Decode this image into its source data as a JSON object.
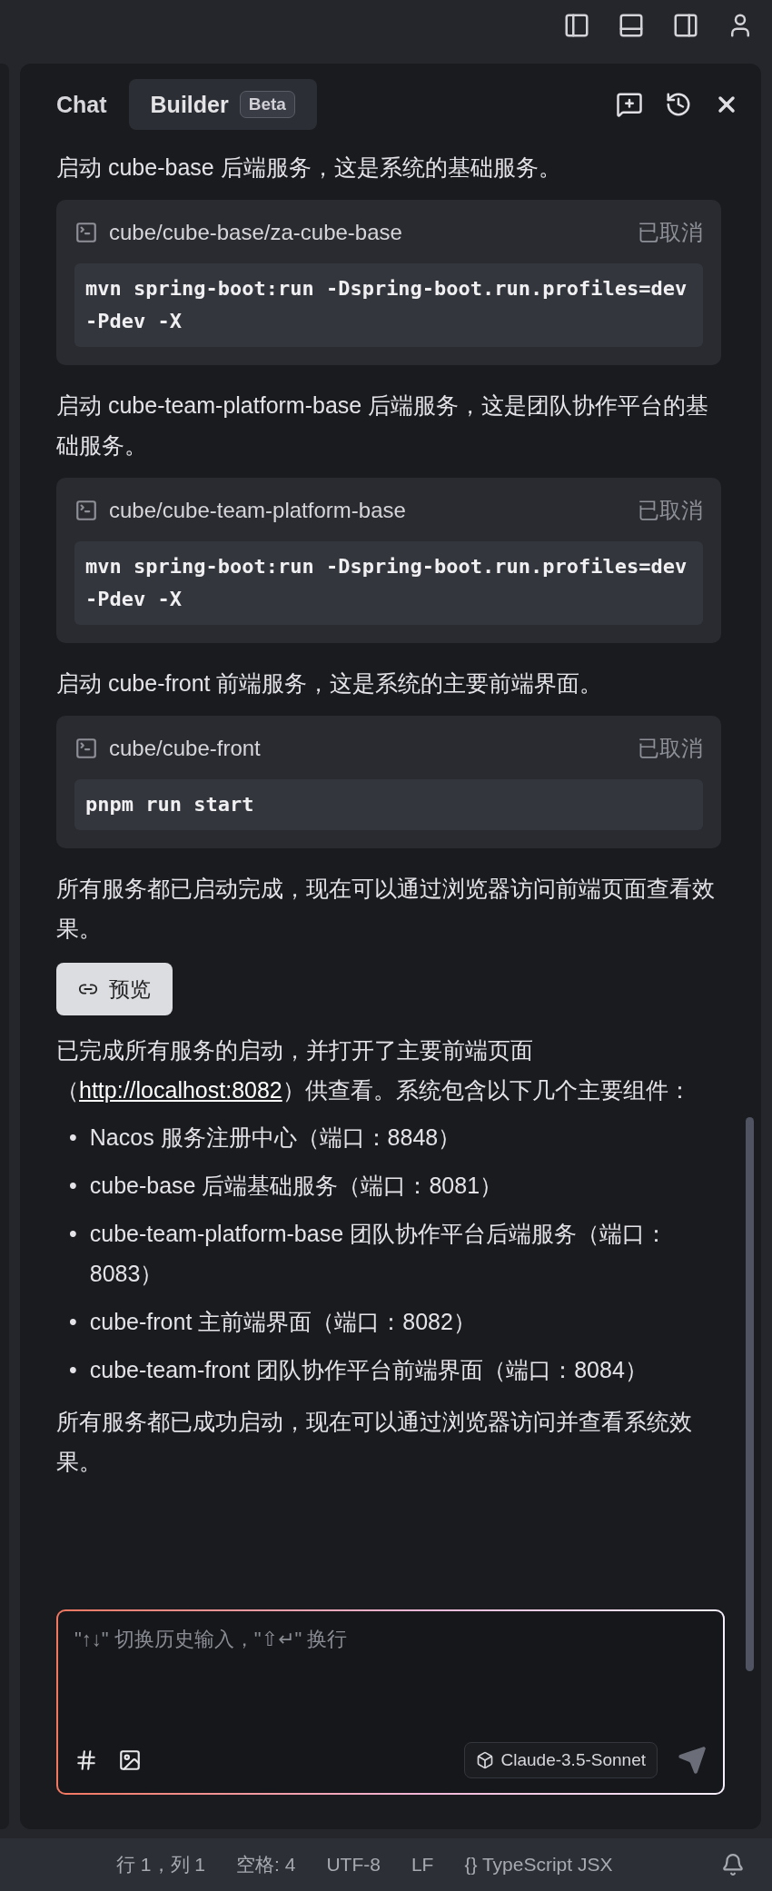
{
  "tabs": [
    {
      "label": "Chat",
      "selected": false
    },
    {
      "label": "Builder",
      "selected": true,
      "badge": "Beta"
    }
  ],
  "messages": [
    {
      "kind": "text",
      "text": "启动 cube-base 后端服务，这是系统的基础服务。"
    },
    {
      "kind": "command",
      "path": "cube/cube-base/za-cube-base",
      "status": "已取消",
      "command": "mvn spring-boot:run -Dspring-boot.run.profiles=dev -Pdev -X"
    },
    {
      "kind": "text",
      "text": "启动 cube-team-platform-base 后端服务，这是团队协作平台的基础服务。"
    },
    {
      "kind": "command",
      "path": "cube/cube-team-platform-base",
      "status": "已取消",
      "command": "mvn spring-boot:run -Dspring-boot.run.profiles=dev -Pdev -X"
    },
    {
      "kind": "text",
      "text": "启动 cube-front 前端服务，这是系统的主要前端界面。"
    },
    {
      "kind": "command",
      "path": "cube/cube-front",
      "status": "已取消",
      "command": "pnpm run start"
    },
    {
      "kind": "text",
      "text": "所有服务都已启动完成，现在可以通过浏览器访问前端页面查看效果。"
    },
    {
      "kind": "button",
      "label": "预览"
    },
    {
      "kind": "link_text",
      "before": "已完成所有服务的启动，并打开了主要前端页面（",
      "link": "http://localhost:8082",
      "after": "）供查看。系统包含以下几个主要组件："
    },
    {
      "kind": "list",
      "items": [
        {
          "marker": "•",
          "text": "Nacos 服务注册中心（端口：8848）"
        },
        {
          "marker": "•",
          "text": "cube-base 后端基础服务（端口：8081）"
        },
        {
          "marker": "•",
          "text": "cube-team-platform-base 团队协作平台后端服务（端口：8083）"
        },
        {
          "marker": "•",
          "text": "cube-front 主前端界面（端口：8082）"
        },
        {
          "marker": "•",
          "text": "cube-team-front 团队协作平台前端界面（端口：8084）"
        }
      ]
    },
    {
      "kind": "text",
      "text": "所有服务都已成功启动，现在可以通过浏览器访问并查看系统效果。"
    }
  ],
  "input": {
    "placeholder": "\"↑↓\" 切换历史输入，\"⇧↵\" 换行",
    "model": "Claude-3.5-Sonnet"
  },
  "status_bar": [
    {
      "kind": "text",
      "text": "行 1，列 1"
    },
    {
      "kind": "text",
      "text": "空格: 4"
    },
    {
      "kind": "text",
      "text": "UTF-8"
    },
    {
      "kind": "text",
      "text": "LF"
    },
    {
      "kind": "language",
      "icon": "{}",
      "text": "TypeScript JSX"
    }
  ]
}
